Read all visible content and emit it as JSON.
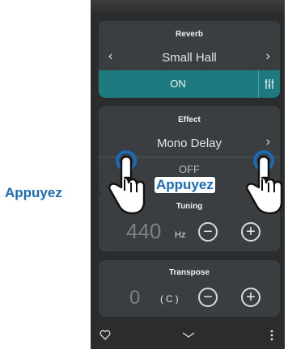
{
  "reverb": {
    "title": "Reverb",
    "value": "Small Hall",
    "toggle_label": "ON"
  },
  "effect": {
    "title": "Effect",
    "value": "Mono Delay",
    "toggle_label": "OFF"
  },
  "tuning": {
    "title": "Tuning",
    "value": "440",
    "unit": "Hz"
  },
  "transpose": {
    "title": "Transpose",
    "value": "0",
    "unit": "(C)"
  },
  "callouts": {
    "left": "Appuyez",
    "right": "Appuyez"
  },
  "colors": {
    "accent": "#1d7a7f",
    "callout_text": "#1a6bb5"
  },
  "icons": {
    "reverb_prev": "chevron-left-icon",
    "reverb_next": "chevron-right-icon",
    "adjust": "sliders-icon",
    "effect_next": "chevron-right-icon",
    "minus": "minus-icon",
    "plus": "plus-icon",
    "favorite": "heart-icon",
    "collapse": "chevron-down-icon",
    "more": "more-vertical-icon",
    "tap": "hand-tap-icon"
  }
}
